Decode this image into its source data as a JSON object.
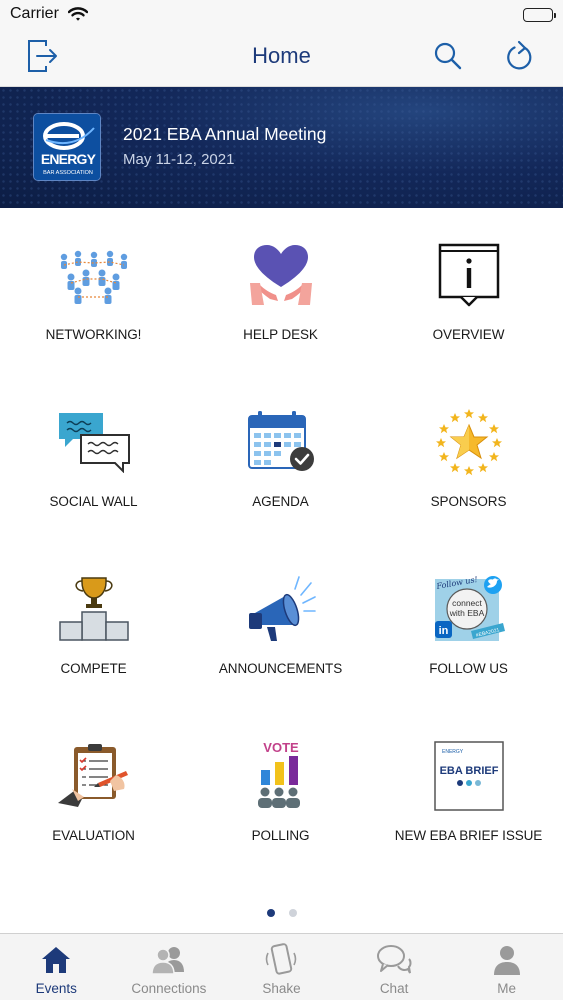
{
  "status_bar": {
    "carrier": "Carrier"
  },
  "nav": {
    "title": "Home"
  },
  "banner": {
    "logo_text": "ENERGY BAR ASSOCIATION",
    "title": "2021 EBA Annual Meeting",
    "date": "May 11-12, 2021"
  },
  "tiles": [
    {
      "label": "NETWORKING!"
    },
    {
      "label": "HELP DESK"
    },
    {
      "label": "OVERVIEW"
    },
    {
      "label": "SOCIAL WALL"
    },
    {
      "label": "AGENDA"
    },
    {
      "label": "SPONSORS"
    },
    {
      "label": "COMPETE"
    },
    {
      "label": "ANNOUNCEMENTS"
    },
    {
      "label": "FOLLOW US"
    },
    {
      "label": "EVALUATION"
    },
    {
      "label": "POLLING"
    },
    {
      "label": "NEW EBA BRIEF ISSUE"
    }
  ],
  "tile_art": {
    "vote": "VOTE",
    "follow_script": "Follow us!",
    "connect_line1": "connect",
    "connect_line2": "with EBA",
    "hashtag": "#EBA2021",
    "brief_header": "ENERGY",
    "brief_title": "EBA BRIEF"
  },
  "page_indicator": {
    "current": 1,
    "total": 2
  },
  "tabs": [
    {
      "label": "Events",
      "icon": "home-icon",
      "active": true
    },
    {
      "label": "Connections",
      "icon": "people-icon",
      "active": false
    },
    {
      "label": "Shake",
      "icon": "phone-shake-icon",
      "active": false
    },
    {
      "label": "Chat",
      "icon": "chat-bubbles-icon",
      "active": false
    },
    {
      "label": "Me",
      "icon": "person-icon",
      "active": false
    }
  ],
  "colors": {
    "accent": "#1d3a7a",
    "banner_bg": "#13285a",
    "tab_inactive": "#8a8a8a"
  }
}
